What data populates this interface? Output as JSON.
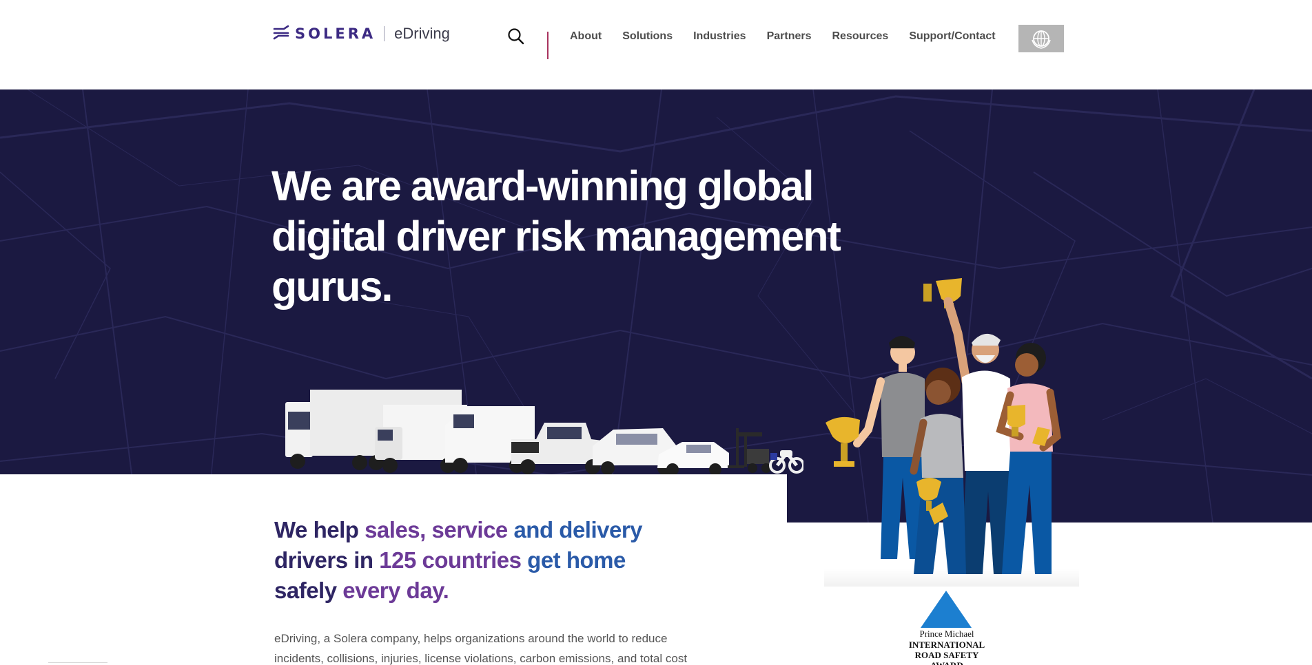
{
  "brand": {
    "company": "SOLERA",
    "product": "eDriving",
    "primary_color": "#3c2a83",
    "accent_color": "#a8325e"
  },
  "header": {
    "search_icon": "search-icon",
    "nav": [
      {
        "label": "About"
      },
      {
        "label": "Solutions"
      },
      {
        "label": "Industries"
      },
      {
        "label": "Partners"
      },
      {
        "label": "Resources"
      },
      {
        "label": "Support/Contact"
      }
    ],
    "language_icon": "globe-icon"
  },
  "hero": {
    "title": "We are award-winning global digital driver risk management gurus.",
    "background_color": "#1b1941"
  },
  "tagline": {
    "line1_dark": "We help ",
    "line1_purple": "sales, service ",
    "line1_blue": "and delivery",
    "line2_dark": "drivers in ",
    "line2_purple": "125 countries ",
    "line2_blue": "get home",
    "line3_dark": "safely ",
    "line3_purple": "every day."
  },
  "body": {
    "text": "eDriving, a Solera company, helps organizations around the world to reduce incidents, collisions, injuries, license violations, carbon emissions, and total cost"
  },
  "award": {
    "sponsor": "Prince Michael",
    "name_line1": "INTERNATIONAL",
    "name_line2": "ROAD SAFETY AWARD"
  }
}
